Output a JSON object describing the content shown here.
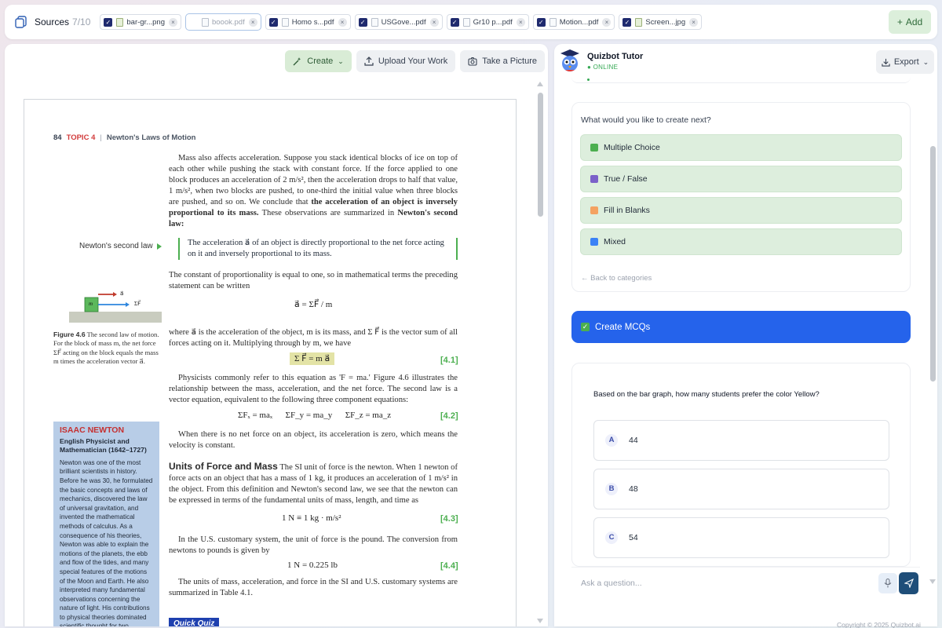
{
  "sources": {
    "label": "Sources",
    "count": "7/10",
    "add_label": "Add",
    "files": [
      {
        "name": "bar-gr...png",
        "checked": true,
        "type": "image"
      },
      {
        "name": "boook.pdf",
        "checked": false,
        "type": "pdf"
      },
      {
        "name": "Homo s...pdf",
        "checked": true,
        "type": "pdf"
      },
      {
        "name": "USGove...pdf",
        "checked": true,
        "type": "pdf"
      },
      {
        "name": "Gr10 p...pdf",
        "checked": true,
        "type": "pdf"
      },
      {
        "name": "Motion...pdf",
        "checked": true,
        "type": "pdf"
      },
      {
        "name": "Screen...jpg",
        "checked": true,
        "type": "image"
      }
    ]
  },
  "doc_toolbar": {
    "create": "Create",
    "upload": "Upload Your Work",
    "picture": "Take a Picture"
  },
  "page": {
    "number": "84",
    "topic": "TOPIC 4",
    "sep": "|",
    "chapter": "Newton's Laws of Motion",
    "p1": "Mass also affects acceleration. Suppose you stack identical blocks of ice on top of each other while pushing the stack with constant force. If the force applied to one block produces an acceleration of 2 m/s², then the acceleration drops to half that value, 1 m/s², when two blocks are pushed, to one-third the initial value when three blocks are pushed, and so on. We conclude that",
    "p1_bold": "the acceleration of an object is inversely proportional to its mass.",
    "p1_tail": "These observations are summarized in",
    "p1_bold2": "Newton's second law:",
    "margin_label": "Newton's second law",
    "law": "The acceleration a⃗ of an object is directly proportional to the net force acting on it and inversely proportional to its mass.",
    "p2": "The constant of proportionality is equal to one, so in mathematical terms the preceding statement can be written",
    "eq1": "a⃗ = ΣF⃗ / m",
    "p3": "where a⃗ is the acceleration of the object, m is its mass, and Σ F⃗ is the vector sum of all forces acting on it. Multiplying through by m, we have",
    "eq2": "Σ F⃗ = m a⃗",
    "eq2_num": "[4.1]",
    "p4": "Physicists commonly refer to this equation as 'F = ma.' Figure 4.6 illustrates the relationship between the mass, acceleration, and the net force. The second law is a vector equation, equivalent to the following three component equations:",
    "eq3": "ΣFₓ = maₓ      ΣF_y = ma_y      ΣF_z = ma_z",
    "eq3_num": "[4.2]",
    "p5": "When there is no net force on an object, its acceleration is zero, which means the velocity is constant.",
    "sec_head": "Units of Force and Mass",
    "p6": "The SI unit of force is the newton. When 1 newton of force acts on an object that has a mass of 1 kg, it produces an acceleration of 1 m/s² in the object. From this definition and Newton's second law, we see that the newton can be expressed in terms of the fundamental units of mass, length, and time as",
    "eq4": "1 N ≡ 1 kg · m/s²",
    "eq4_num": "[4.3]",
    "p7": "In the U.S. customary system, the unit of force is the pound. The conversion from newtons to pounds is given by",
    "eq5": "1 N = 0.225 lb",
    "eq5_num": "[4.4]",
    "p8": "The units of mass, acceleration, and force in the SI and U.S. customary systems are summarized in Table 4.1.",
    "quick_quiz": "Quick Quiz",
    "fig_label": "Figure 4.6",
    "fig_caption": "The second law of motion. For the block of mass m, the net force ΣF⃗ acting on the block equals the mass m times the acceleration vector a⃗.",
    "fig_mass": "m",
    "fig_a": "a⃗",
    "fig_f": "ΣF⃗",
    "bio_name": "ISAAC NEWTON",
    "bio_role": "English Physicist and Mathematician (1642–1727)",
    "bio_text": "Newton was one of the most brilliant scientists in history. Before he was 30, he formulated the basic concepts and laws of mechanics, discovered the law of universal gravitation, and invented the mathematical methods of calculus. As a consequence of his theories, Newton was able to explain the motions of the planets, the ebb and flow of the tides, and many special features of the motions of the Moon and Earth. He also interpreted many fundamental observations concerning the nature of light. His contributions to physical theories dominated scientific thought for two centuries and"
  },
  "tutor": {
    "name": "Quizbot Tutor",
    "status": "● ONLINE",
    "export": "Export"
  },
  "create_card": {
    "question": "What would you like to create next?",
    "options": [
      "Multiple Choice",
      "True / False",
      "Fill in Blanks",
      "Mixed"
    ],
    "option_icon_colors": [
      "#4caf50",
      "#7b61c9",
      "#f4a261",
      "#3b82f6"
    ],
    "back": "← Back to categories"
  },
  "create_mcq": "Create MCQs",
  "quiz": {
    "question": "Based on the bar graph, how many students prefer the color Yellow?",
    "answers": [
      {
        "letter": "A",
        "text": "44"
      },
      {
        "letter": "B",
        "text": "48"
      },
      {
        "letter": "C",
        "text": "54"
      }
    ]
  },
  "ask": {
    "placeholder": "Ask a question..."
  },
  "footer": "Copyright © 2025 Quizbot.ai"
}
